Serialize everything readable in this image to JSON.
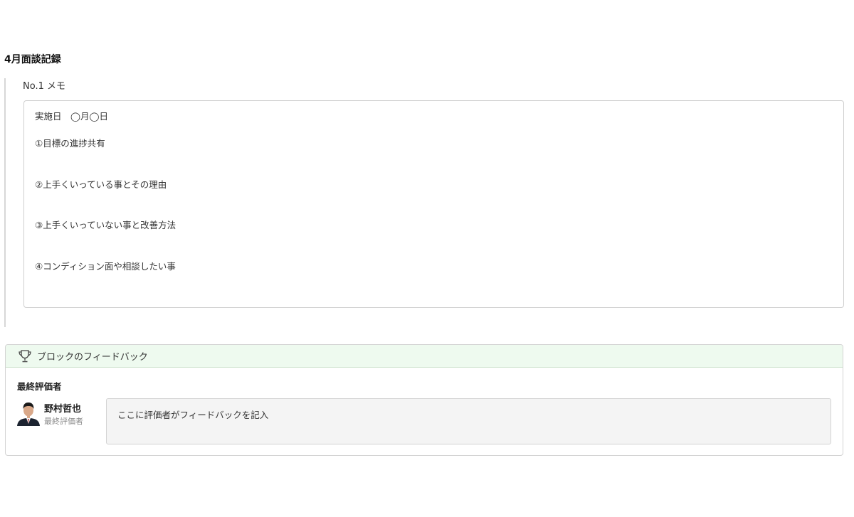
{
  "section": {
    "title": "4月面談記録"
  },
  "memo": {
    "label": "No.1  メモ",
    "lines": [
      "実施日　◯月◯日",
      "①目標の進捗共有",
      "②上手くいっている事とその理由",
      "③上手くいっていない事と改善方法",
      "④コンディション面や相談したい事"
    ]
  },
  "feedback": {
    "title": "ブロックのフィードバック",
    "evaluator_heading": "最終評価者",
    "evaluator": {
      "name": "野村哲也",
      "role": "最終評価者"
    },
    "comment": "ここに評価者がフィードバックを記入"
  },
  "colors": {
    "header_bg": "#eefaef",
    "input_bg": "#f4f4f4",
    "border": "#d3d3d3"
  },
  "icons": {
    "feedback": "trophy-icon",
    "avatar": "person-avatar"
  }
}
